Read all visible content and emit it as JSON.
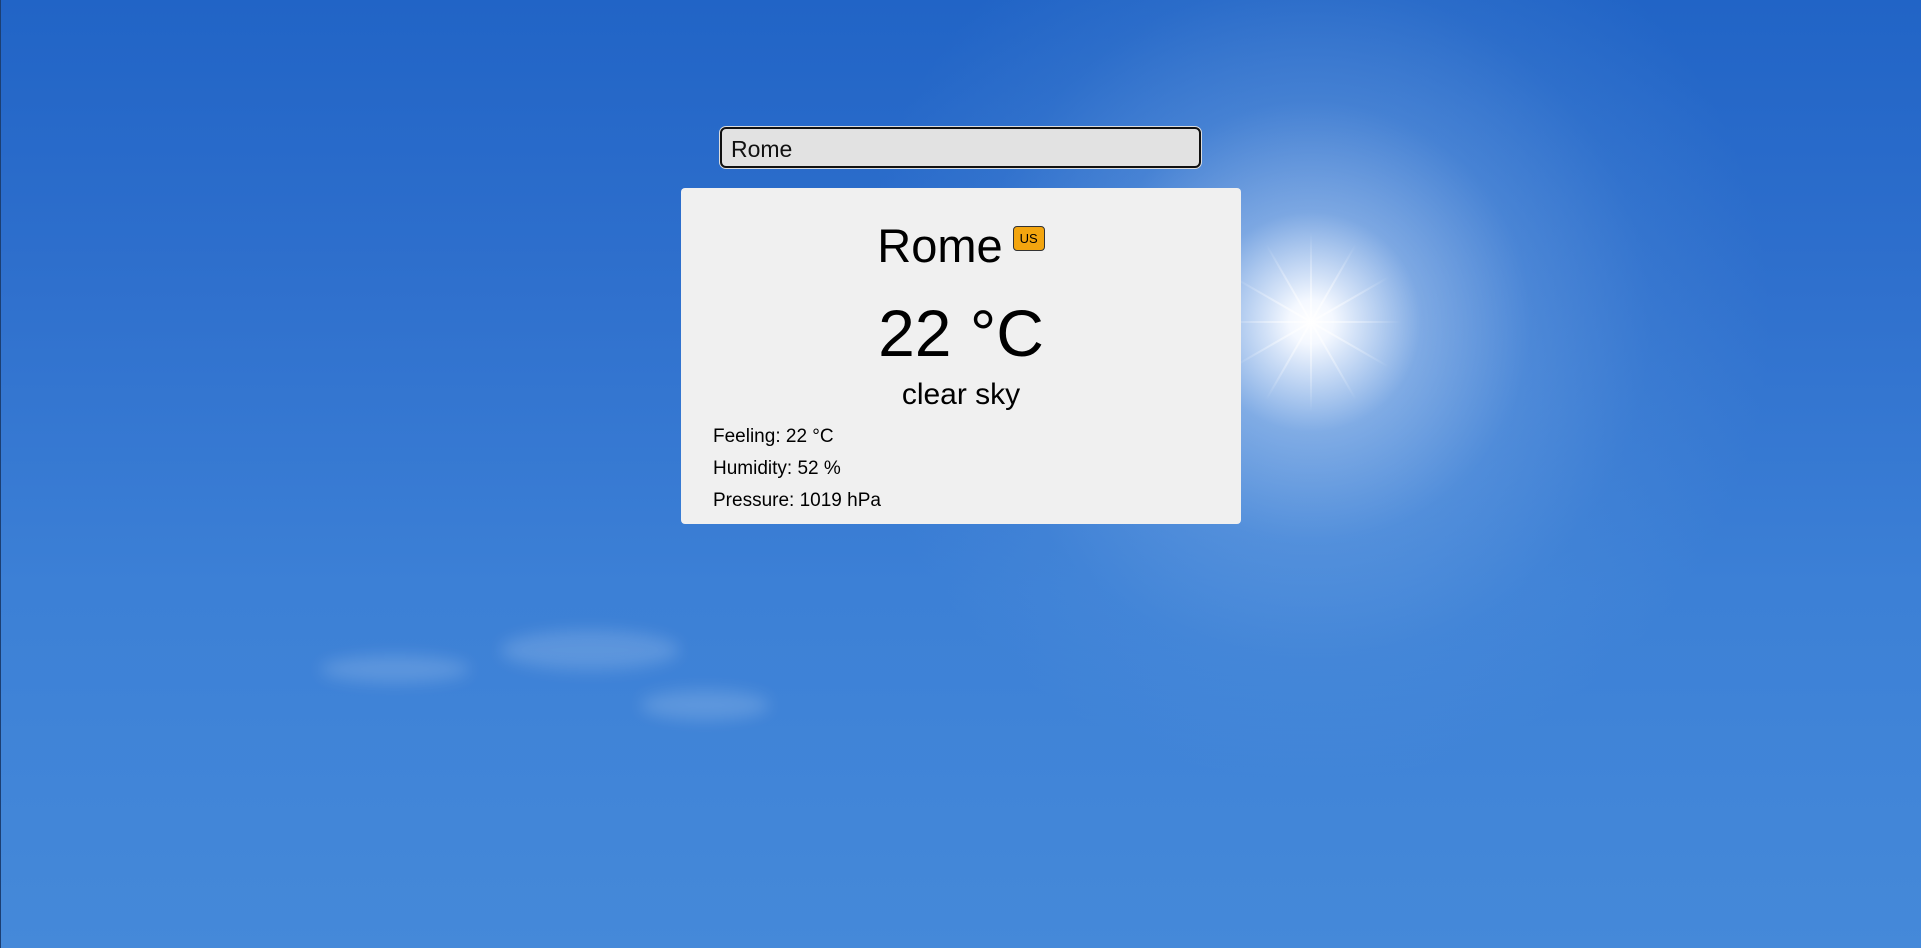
{
  "search": {
    "value": "Rome"
  },
  "weather": {
    "city": "Rome",
    "country_code": "US",
    "temperature": "22 °C",
    "description": "clear sky",
    "feeling": "Feeling: 22 °C",
    "humidity": "Humidity: 52 %",
    "pressure": "Pressure: 1019 hPa"
  },
  "colors": {
    "sky_top": "#2164c6",
    "sky_bottom": "#4589d9",
    "card_background": "#f0f0f0",
    "badge_background": "#f3a50f",
    "input_background": "#e2e2e2"
  },
  "background": {
    "icon": "sun-icon"
  }
}
